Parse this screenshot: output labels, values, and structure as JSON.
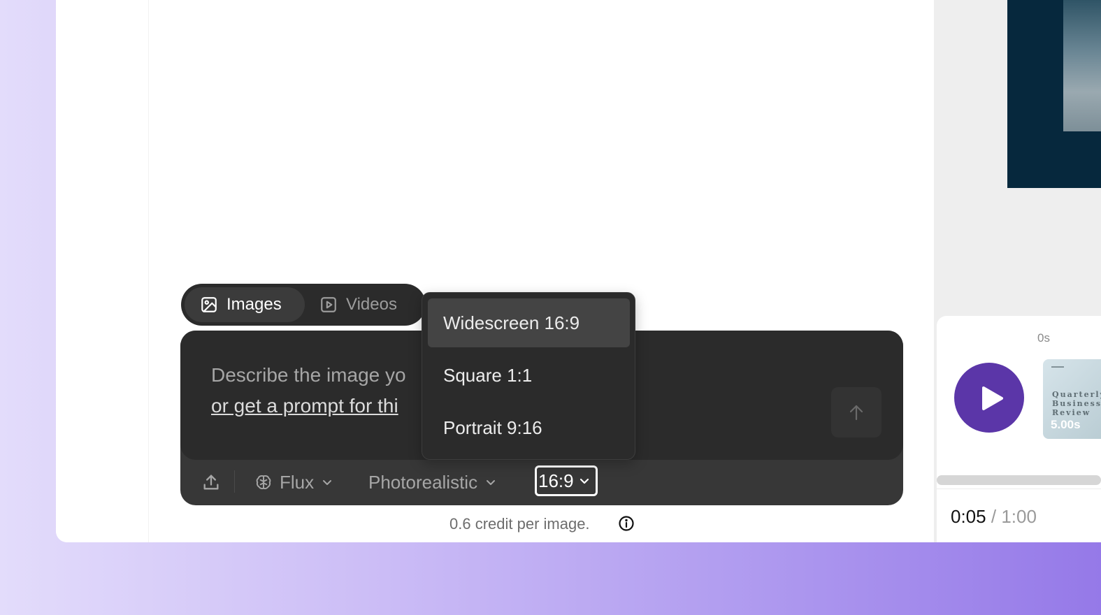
{
  "mode_tabs": [
    {
      "label": "Images",
      "icon": "image-icon",
      "active": true
    },
    {
      "label": "Videos",
      "icon": "video-icon",
      "active": false
    }
  ],
  "composer": {
    "placeholder": "Describe the image yo",
    "prompt_link": "or get a prompt for thi",
    "send_icon": "arrow-up-icon"
  },
  "toolbar": {
    "upload_icon": "upload-icon",
    "model_label": "Flux",
    "model_icon": "brain-icon",
    "style_label": "Photorealistic",
    "ratio_label": "16:9"
  },
  "ratio_menu": {
    "items": [
      {
        "label": "Widescreen 16:9",
        "active": true
      },
      {
        "label": "Square 1:1",
        "active": false
      },
      {
        "label": "Portrait 9:16",
        "active": false
      }
    ]
  },
  "footer": {
    "credit_text": "0.6 credit per image.",
    "info_icon": "info-icon"
  },
  "timeline": {
    "marker": "0s",
    "play_icon": "play-icon",
    "thumbnail": {
      "title": "Quarterly\nBusiness\nReview",
      "duration": "5.00s"
    },
    "current_time": "0:05",
    "separator": "/",
    "total_time": "1:00"
  },
  "colors": {
    "accent_play": "#5b36a8",
    "composer_bg": "#2b2b2b",
    "toolbar_bg": "#373737",
    "right_image_bg": "#06283d"
  }
}
